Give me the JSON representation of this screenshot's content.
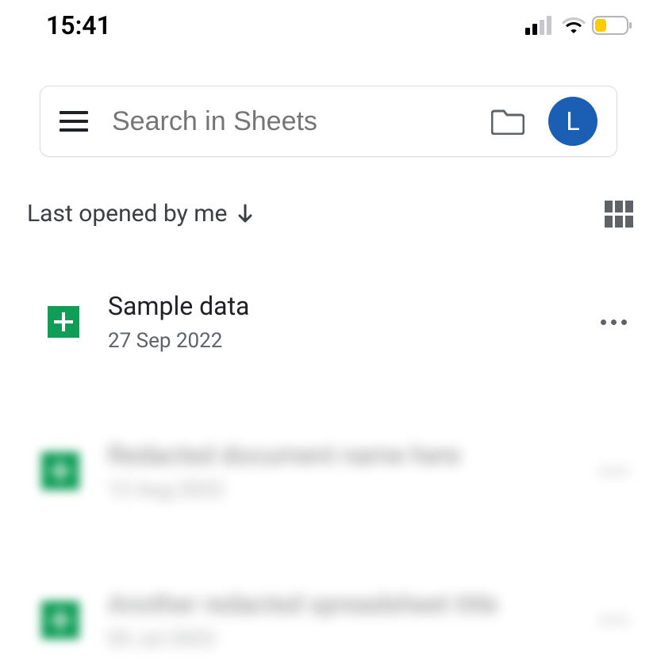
{
  "status": {
    "time": "15:41"
  },
  "search": {
    "placeholder": "Search in Sheets"
  },
  "avatar": {
    "initial": "L",
    "color": "#1a5fb4"
  },
  "sort": {
    "label": "Last opened by me"
  },
  "files": [
    {
      "title": "Sample data",
      "date": "27 Sep 2022",
      "blurred": false
    },
    {
      "title": "Redacted document name here",
      "date": "12 Aug 2022",
      "blurred": true
    },
    {
      "title": "Another redacted spreadsheet title",
      "date": "03 Jul 2022",
      "blurred": true
    }
  ]
}
